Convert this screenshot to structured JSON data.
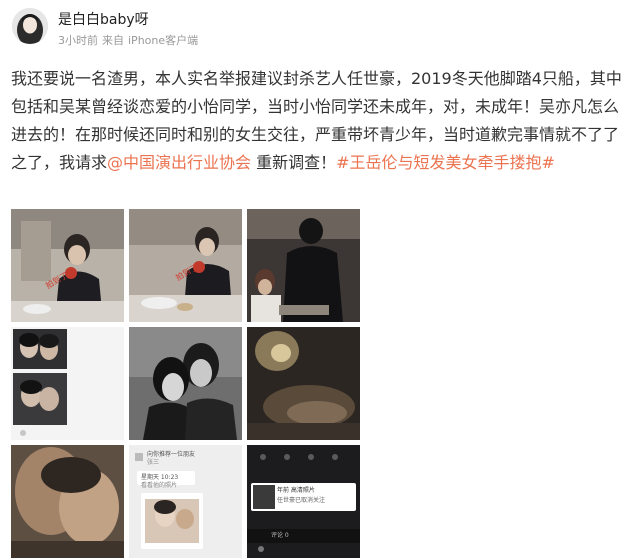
{
  "post": {
    "author": "是白白baby呀",
    "time": "3小时前",
    "source_prefix": "来自",
    "source": "iPhone客户端",
    "text_segments": [
      {
        "type": "text",
        "value": "我还要说一名渣男，本人实名举报建议封杀艺人任世豪，2019冬天他脚踏4只船，其中包括和吴某曾经谈恋爱的小怡同学，当时小怡同学还未成年，对，未成年！吴亦凡怎么进去的！在那时候还同时和别的女生交往，严重带坏青少年，当时道歉完事情就不了了之了，我请求"
      },
      {
        "type": "mention",
        "value": "@中国演出行业协会"
      },
      {
        "type": "text",
        "value": " 重新调查！"
      },
      {
        "type": "hashtag",
        "value": "#王岳伦与短发美女牵手搂抱#"
      }
    ]
  },
  "images": [
    {
      "label": "photo-1",
      "watermark": "拍到了"
    },
    {
      "label": "photo-2",
      "watermark": "拍到了"
    },
    {
      "label": "photo-3"
    },
    {
      "label": "photo-4"
    },
    {
      "label": "photo-5"
    },
    {
      "label": "photo-6"
    },
    {
      "label": "photo-7"
    },
    {
      "label": "photo-8",
      "lines": [
        "向你推荐一位朋友",
        "张三",
        "星期天 10:23",
        "看看他的照片"
      ]
    },
    {
      "label": "photo-9",
      "lines": [
        "年前 高清照片",
        "任世豪已取消关注",
        "评论 0"
      ]
    }
  ],
  "colors": {
    "link": "#eb7350",
    "text": "#333333",
    "meta": "#999999"
  }
}
